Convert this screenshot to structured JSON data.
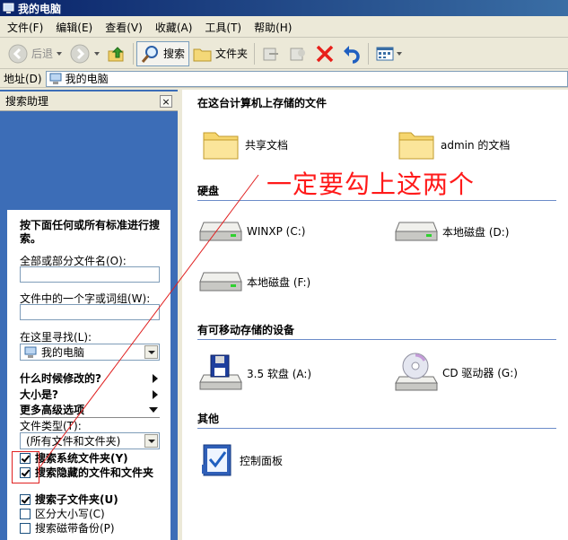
{
  "window": {
    "title": "我的电脑"
  },
  "menu": [
    "文件(F)",
    "编辑(E)",
    "查看(V)",
    "收藏(A)",
    "工具(T)",
    "帮助(H)"
  ],
  "toolbar": {
    "back": "后退",
    "search": "搜索",
    "folders": "文件夹"
  },
  "address": {
    "label": "地址(D)",
    "value": "我的电脑"
  },
  "search_pane": {
    "header": "搜索助理",
    "close": "×",
    "intro": "按下面任何或所有标准进行搜索。",
    "filename_label": "全部或部分文件名(O):",
    "filename_value": "",
    "word_label": "文件中的一个字或词组(W):",
    "word_value": "",
    "lookin_label": "在这里寻找(L):",
    "lookin_value": "我的电脑",
    "when_modified": "什么时候修改的?",
    "size": "大小是?",
    "advanced": "更多高级选项",
    "filetype_label": "文件类型(T):",
    "filetype_value": "(所有文件和文件夹)",
    "options": [
      {
        "label": "搜索系统文件夹(Y)",
        "checked": true,
        "bold": true
      },
      {
        "label": "搜索隐藏的文件和文件夹",
        "checked": true,
        "bold": true
      },
      {
        "label": "搜索子文件夹(U)",
        "checked": true,
        "bold": true
      },
      {
        "label": "区分大小写(C)",
        "checked": false,
        "bold": false
      },
      {
        "label": "搜索磁带备份(P)",
        "checked": false,
        "bold": false
      }
    ]
  },
  "groups": {
    "stored": "在这台计算机上存储的文件",
    "hdd": "硬盘",
    "removable": "有可移动存储的设备",
    "other": "其他"
  },
  "items": {
    "shared_docs": "共享文档",
    "admin_docs": "admin 的文档",
    "drive_c": "WINXP (C:)",
    "drive_d": "本地磁盘 (D:)",
    "drive_f": "本地磁盘 (F:)",
    "floppy": "3.5 软盘 (A:)",
    "cd": "CD 驱动器 (G:)",
    "control_panel": "控制面板"
  },
  "annotation": "一定要勾上这两个",
  "colors": {
    "annotation": "#ff1a1a",
    "titlebar": "#0a246a",
    "leftpane": "#3c6db7"
  }
}
